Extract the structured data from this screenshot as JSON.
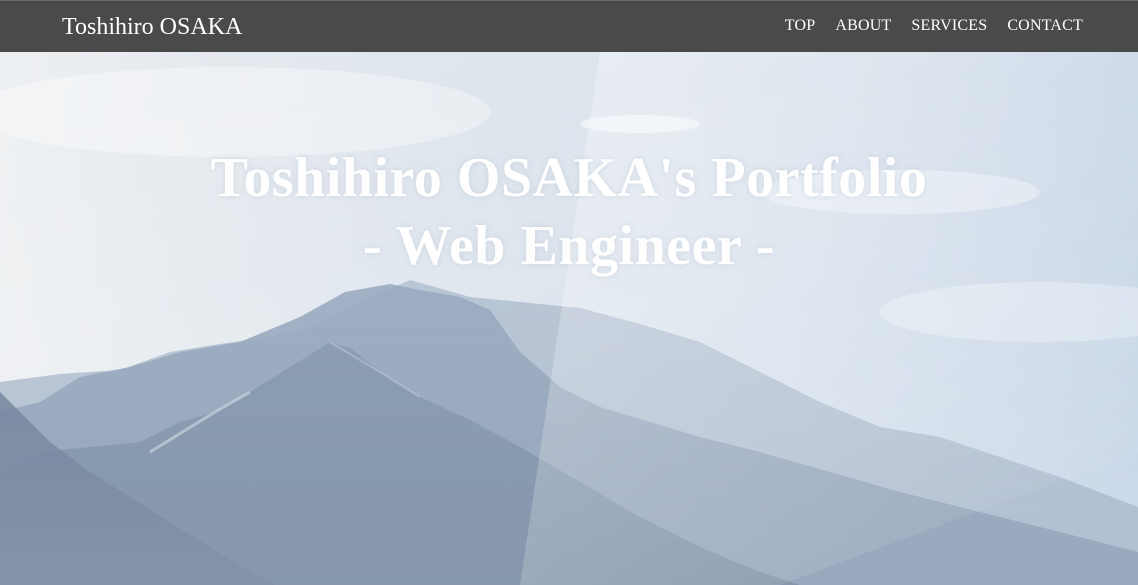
{
  "navbar": {
    "brand": "Toshihiro OSAKA",
    "links": [
      {
        "label": "TOP"
      },
      {
        "label": "ABOUT"
      },
      {
        "label": "SERVICES"
      },
      {
        "label": "CONTACT"
      }
    ]
  },
  "hero": {
    "title_line1": "Toshihiro OSAKA's Portfolio",
    "title_line2": "- Web Engineer -",
    "background_image": "misty-mountain-landscape"
  },
  "colors": {
    "navbar_bg": "#4a4a4a",
    "nav_text": "#ffffff",
    "hero_text": "#ffffff",
    "sky": "#c9d6e5",
    "mountain": "#6a7d96"
  }
}
